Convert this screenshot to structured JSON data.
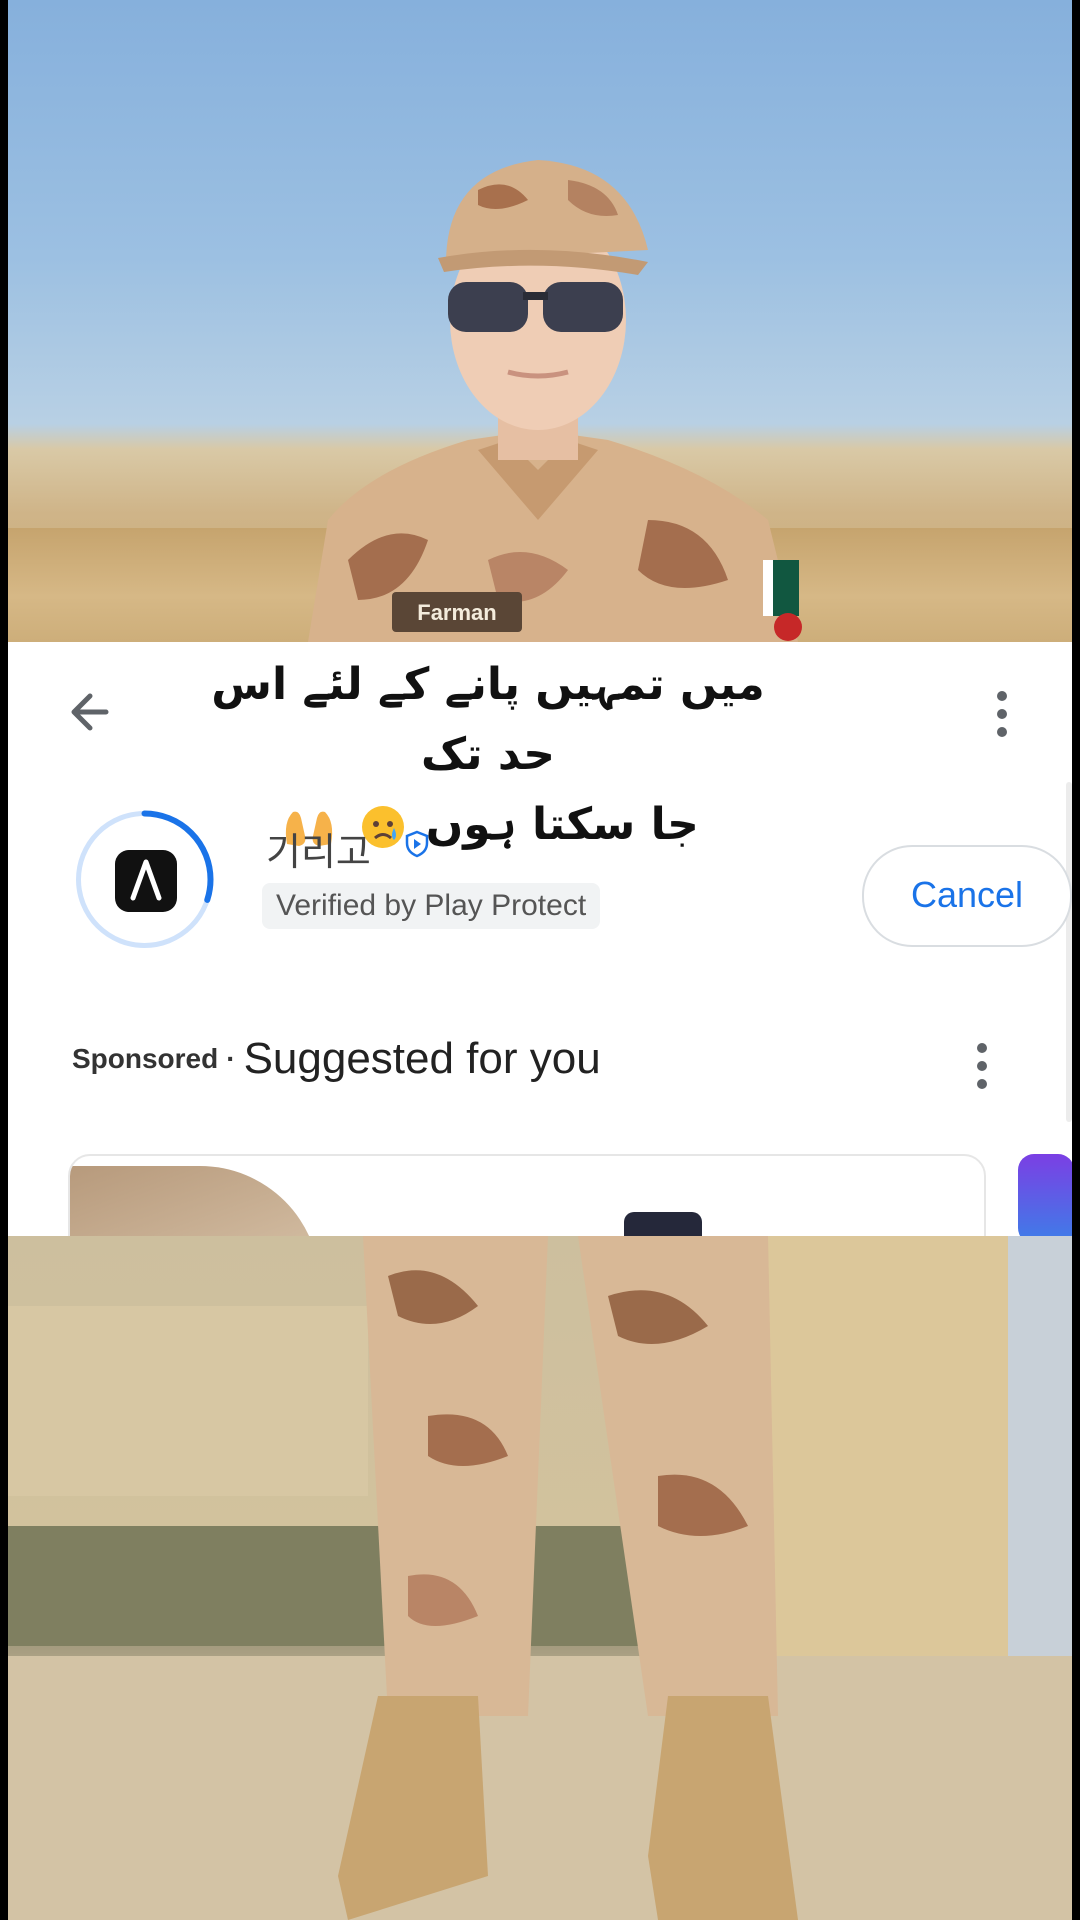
{
  "top_photo": {
    "name_tag": "Farman"
  },
  "caption": {
    "line1": "میں تمہیں پانے کے لئے اس حد تک",
    "line2": "جا سکتا ہوں"
  },
  "app_install": {
    "app_name": "기리고",
    "verified_label": "Verified by Play Protect",
    "cancel_label": "Cancel",
    "progress": 0.3
  },
  "suggestions": {
    "sponsored_label": "Sponsored",
    "separator": "·",
    "title": "Suggested for you"
  },
  "icons": [
    "back-arrow-icon",
    "more-vert-icon",
    "play-protect-shield-icon",
    "crying-face-emoji",
    "palms-up-emoji"
  ],
  "colors": {
    "accent": "#1a73e8",
    "progress_ring": "#1a73e8",
    "camo_light": "#d8b896",
    "camo_dark": "#9a6a4a"
  }
}
